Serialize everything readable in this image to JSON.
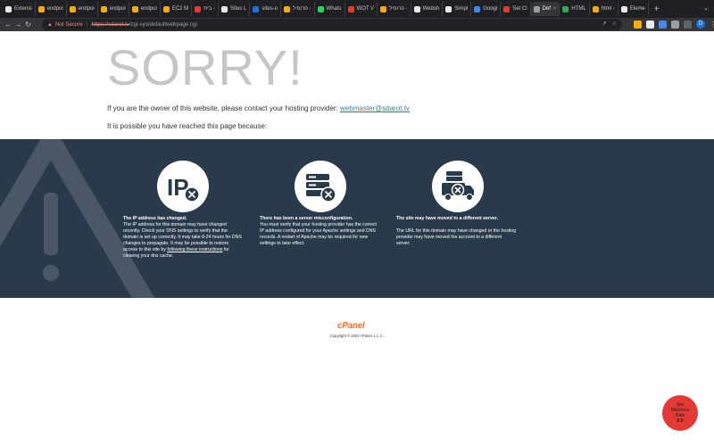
{
  "browser": {
    "tabs": [
      {
        "label": "Extensi",
        "color": "#e8eaed",
        "active": false
      },
      {
        "label": "endpoi",
        "color": "#f9ab00",
        "active": false
      },
      {
        "label": "endpoi",
        "color": "#f9ab00",
        "active": false
      },
      {
        "label": "endpoi",
        "color": "#f9ab00",
        "active": false
      },
      {
        "label": "endpoi",
        "color": "#f9ab00",
        "active": false
      },
      {
        "label": "EC2 M",
        "color": "#f9ab00",
        "active": false
      },
      {
        "label": "בית -",
        "color": "#e53935",
        "active": false
      },
      {
        "label": "Sites L",
        "color": "#e8eaed",
        "active": false
      },
      {
        "label": "sites-o",
        "color": "#1a73e8",
        "active": false
      },
      {
        "label": "פרופיל -",
        "color": "#f9ab00",
        "active": false
      },
      {
        "label": "Whats",
        "color": "#25d366",
        "active": false
      },
      {
        "label": "WOT V",
        "color": "#e53935",
        "active": false
      },
      {
        "label": "פרופיל -",
        "color": "#f9ab00",
        "active": false
      },
      {
        "label": "Websh",
        "color": "#e8eaed",
        "active": false
      },
      {
        "label": "Simpl",
        "color": "#e8eaed",
        "active": false
      },
      {
        "label": "Googl",
        "color": "#4285f4",
        "active": false
      },
      {
        "label": "Set Cl",
        "color": "#e53935",
        "active": false
      },
      {
        "label": "Def",
        "color": "#9aa0a6",
        "active": true
      },
      {
        "label": "HTML",
        "color": "#34a853",
        "active": false
      },
      {
        "label": "html -",
        "color": "#f9ab00",
        "active": false
      },
      {
        "label": "Eleme",
        "color": "#e8eaed",
        "active": false
      }
    ],
    "new_tab": "+",
    "not_secure": "Not Secure",
    "url_host": "https://sdarot.tv",
    "url_path": "/cgi-sys/defaultwebpage.cgi",
    "profile_initial": "D"
  },
  "page": {
    "heading": "SORRY!",
    "owner_text": "If you are the owner of this website, please contact your hosting provider: ",
    "owner_email": "webmaster@sdarot.tv",
    "possible_text": "It is possible you have reached this page because:",
    "reasons": [
      {
        "icon": "ip-address-icon",
        "title": "The IP address has changed.",
        "text": "The IP address for this domain may have changed recently. Check your DNS settings to verify that the domain is set up correctly. It may take 8-24 hours for DNS changes to propagate. It may be possible to restore access to this site by ",
        "link": "following these instructions",
        "text_after": " for clearing your dns cache."
      },
      {
        "icon": "server-error-icon",
        "title": "There has been a server misconfiguration.",
        "text": "You must verify that your hosting provider has the correct IP address configured for your Apache settings and DNS records. A restart of Apache may be required for new settings to take effect."
      },
      {
        "icon": "moved-server-icon",
        "title": "The site may have moved to a different server.",
        "text": "The URL for this domain may have changed or the hosting provider may have moved the account to a different server."
      }
    ],
    "logo": "cPanel",
    "copyright": "Copyright © 2022 cPanel, L.L.C."
  },
  "badge": {
    "line1": "Site",
    "line2": "Malicious",
    "line3": "Rate",
    "value": "9.9"
  }
}
